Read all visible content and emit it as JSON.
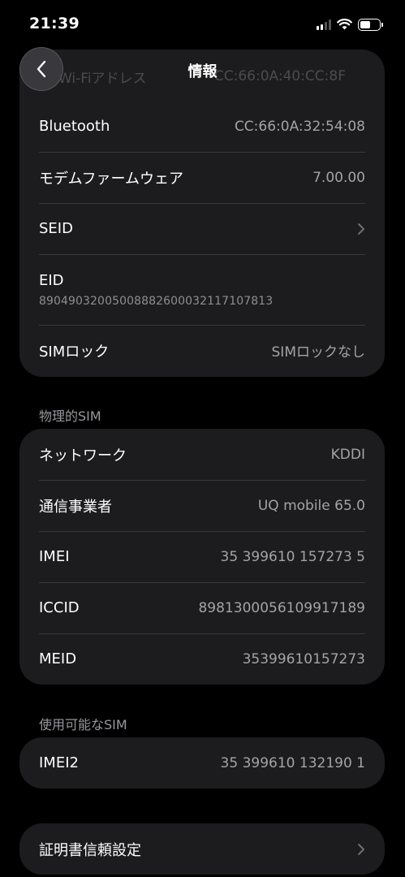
{
  "status_bar": {
    "time": "21:39",
    "battery_level": 0.55
  },
  "header": {
    "title": "情報"
  },
  "device_card": {
    "partial_row": {
      "label": "Wi-Fiアドレス",
      "value": "CC:66:0A:40:CC:8F"
    },
    "rows": [
      {
        "label": "Bluetooth",
        "value": "CC:66:0A:32:54:08"
      },
      {
        "label": "モデムファームウェア",
        "value": "7.00.00"
      },
      {
        "label": "SEID"
      },
      {
        "label": "EID",
        "value": "89049032005008882600032117107813"
      },
      {
        "label": "SIMロック",
        "value": "SIMロックなし"
      }
    ]
  },
  "physical_sim": {
    "title": "物理的SIM",
    "rows": [
      {
        "label": "ネットワーク",
        "value": "KDDI"
      },
      {
        "label": "通信事業者",
        "value": "UQ mobile 65.0"
      },
      {
        "label": "IMEI",
        "value": "35 399610 157273 5"
      },
      {
        "label": "ICCID",
        "value": "8981300056109917189"
      },
      {
        "label": "MEID",
        "value": "35399610157273"
      }
    ]
  },
  "available_sim": {
    "title": "使用可能なSIM",
    "rows": [
      {
        "label": "IMEI2",
        "value": "35 399610 132190 1"
      }
    ]
  },
  "certificate": {
    "label": "証明書信頼設定"
  }
}
